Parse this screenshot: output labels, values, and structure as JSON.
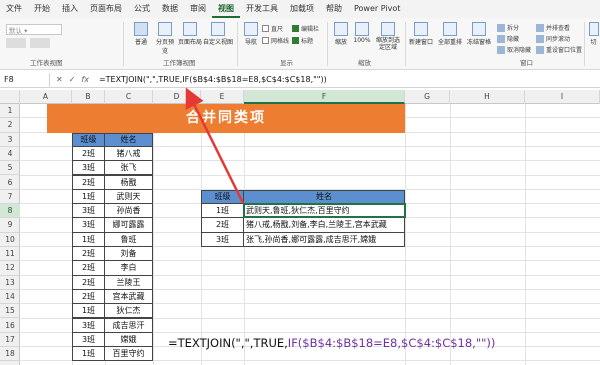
{
  "menu": {
    "items": [
      "文件",
      "开始",
      "插入",
      "页面布局",
      "公式",
      "数据",
      "审阅",
      "视图",
      "开发工具",
      "加载项",
      "帮助",
      "Power Pivot"
    ],
    "active_index": 7
  },
  "ribbon": {
    "sheet_view_default": "默认",
    "group_sheet_view": "工作表视图",
    "normal": "普通",
    "page_break_preview": "分页预览",
    "page_layout": "页面布局",
    "custom_views": "自定义视图",
    "group_workbook_views": "工作簿视图",
    "navigation": "导航",
    "ruler": "直尺",
    "gridlines": "网格线",
    "formula_bar": "编辑栏",
    "headings": "标题",
    "group_show": "显示",
    "zoom": "缩放",
    "zoom_100": "100%",
    "zoom_to_selection": "缩放到选定区域",
    "group_zoom": "缩放",
    "new_window": "新建窗口",
    "arrange_all": "全部重排",
    "freeze_panes": "冻结窗格",
    "split": "拆分",
    "hide": "隐藏",
    "unhide": "取消隐藏",
    "view_side_by_side": "并排查看",
    "sync_scroll": "同步滚动",
    "reset_position": "重设窗口位置",
    "group_window": "窗口",
    "switch": "切"
  },
  "formula_bar": {
    "name_box": "F8",
    "cancel": "✕",
    "enter": "✓",
    "fx": "fx",
    "formula": "=TEXTJOIN(\",\",TRUE,IF($B$4:$B$18=E8,$C$4:$C$18,\"\"))"
  },
  "grid": {
    "columns": [
      "A",
      "B",
      "C",
      "D",
      "E",
      "F",
      "G",
      "H",
      "I"
    ],
    "rows": [
      "1",
      "2",
      "3",
      "4",
      "5",
      "6",
      "7",
      "8",
      "9",
      "10",
      "11",
      "12",
      "13",
      "14",
      "15",
      "16",
      "17",
      "18"
    ],
    "selected_col": "F",
    "selected_row": "8"
  },
  "banner": "合并同类项",
  "left_table": {
    "headers": [
      "班级",
      "姓名"
    ],
    "rows": [
      [
        "2班",
        "猪八戒"
      ],
      [
        "3班",
        "张飞"
      ],
      [
        "2班",
        "杨戬"
      ],
      [
        "1班",
        "武则天"
      ],
      [
        "3班",
        "孙尚香"
      ],
      [
        "3班",
        "娜可露露"
      ],
      [
        "1班",
        "鲁班"
      ],
      [
        "2班",
        "刘备"
      ],
      [
        "2班",
        "李白"
      ],
      [
        "2班",
        "兰陵王"
      ],
      [
        "2班",
        "宫本武藏"
      ],
      [
        "1班",
        "狄仁杰"
      ],
      [
        "3班",
        "成吉思汗"
      ],
      [
        "3班",
        "嫦娥"
      ],
      [
        "1班",
        "百里守约"
      ]
    ]
  },
  "right_table": {
    "headers": [
      "班级",
      "姓名"
    ],
    "rows": [
      [
        "1班",
        "武则天,鲁班,狄仁杰,百里守约"
      ],
      [
        "2班",
        "猪八戒,杨戬,刘备,李白,兰陵王,宫本武藏"
      ],
      [
        "3班",
        "张飞,孙尚香,娜可露露,成吉思汗,嫦娥"
      ]
    ]
  },
  "annotation": {
    "part1": "=TEXTJOIN(\",\",TRUE,",
    "part2": "IF($B$4:$B$18=E8,$C$4:$C$18,\"\"))"
  },
  "colors": {
    "banner": "#ed7d31",
    "table_header": "#5b8fd0",
    "accent": "#217346",
    "arrow": "#e53935",
    "annotation_purple": "#7030a0"
  }
}
